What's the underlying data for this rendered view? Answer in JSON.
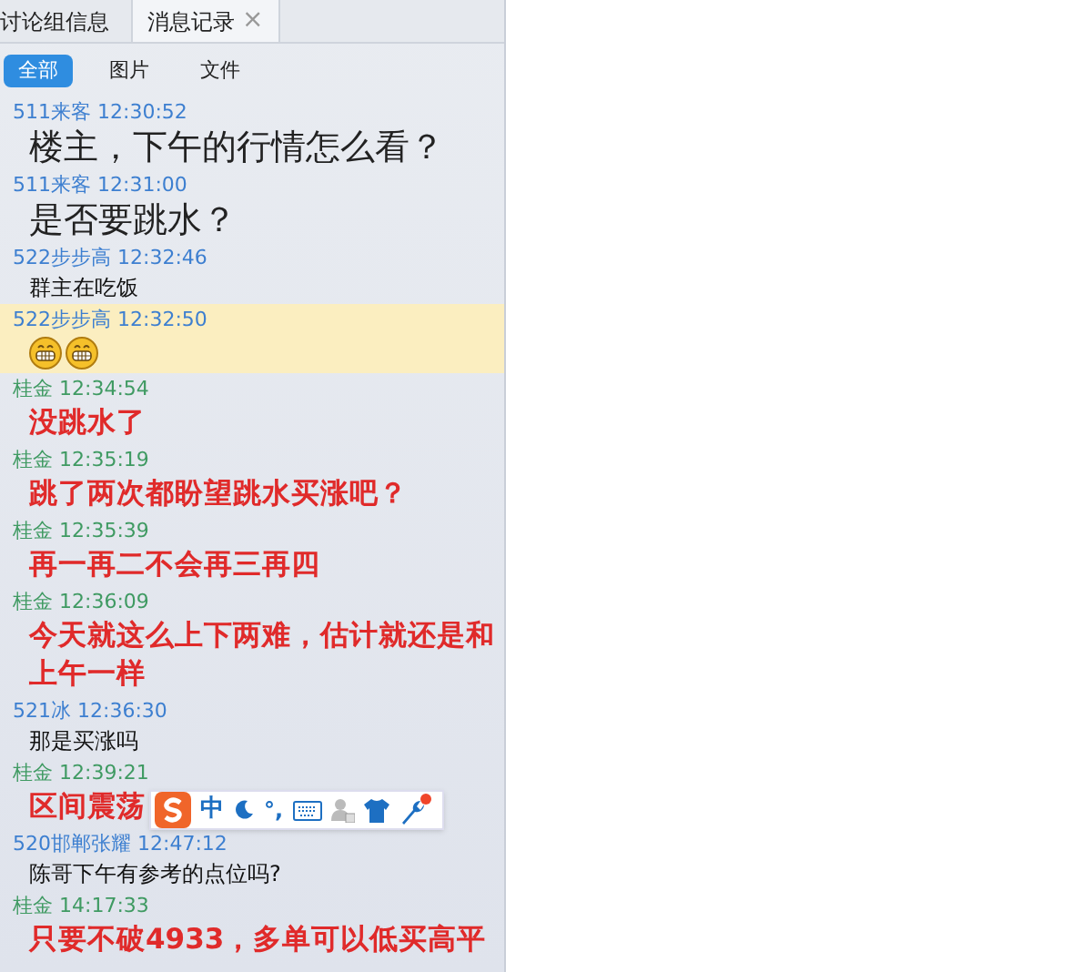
{
  "tabs": [
    {
      "label": "讨论组信息",
      "selected": false
    },
    {
      "label": "消息记录",
      "selected": true,
      "close_glyph": "×"
    }
  ],
  "filters": [
    {
      "label": "全部",
      "selected": true
    },
    {
      "label": "图片",
      "selected": false
    },
    {
      "label": "文件",
      "selected": false
    }
  ],
  "messages": [
    {
      "sender": "511来客",
      "time": "12:30:52",
      "color": "#3d7fd0",
      "kind": "large",
      "text": "楼主，下午的行情怎么看？",
      "selected": false
    },
    {
      "sender": "511来客",
      "time": "12:31:00",
      "color": "#3d7fd0",
      "kind": "large",
      "text": "是否要跳水？",
      "selected": false
    },
    {
      "sender": "522步步高",
      "time": "12:32:46",
      "color": "#3d7fd0",
      "kind": "small",
      "text": "群主在吃饭",
      "selected": false
    },
    {
      "sender": "522步步高",
      "time": "12:32:50",
      "color": "#3d7fd0",
      "kind": "emoji",
      "emojis": [
        {
          "kind": "grin"
        },
        {
          "kind": "grin"
        }
      ],
      "selected": true
    },
    {
      "sender": "桂金",
      "time": "12:34:54",
      "color": "#3f9a62",
      "kind": "red",
      "text": "没跳水了",
      "selected": false
    },
    {
      "sender": "桂金",
      "time": "12:35:19",
      "color": "#3f9a62",
      "kind": "red",
      "text": "跳了两次都盼望跳水买涨吧？",
      "selected": false
    },
    {
      "sender": "桂金",
      "time": "12:35:39",
      "color": "#3f9a62",
      "kind": "red",
      "text": "再一再二不会再三再四",
      "selected": false
    },
    {
      "sender": "桂金",
      "time": "12:36:09",
      "color": "#3f9a62",
      "kind": "red",
      "text": "今天就这么上下两难，估计就还是和上午一样",
      "selected": false
    },
    {
      "sender": "521冰",
      "time": "12:36:30",
      "color": "#3d7fd0",
      "kind": "small",
      "text": "那是买涨吗",
      "selected": false
    },
    {
      "sender": "桂金",
      "time": "12:39:21",
      "color": "#3f9a62",
      "kind": "red",
      "text": "区间震荡",
      "selected": false
    },
    {
      "sender": "520邯郸张耀",
      "time": "12:47:12",
      "color": "#3d7fd0",
      "kind": "small",
      "text": "陈哥下午有参考的点位吗?",
      "selected": false
    },
    {
      "sender": "桂金",
      "time": "14:17:33",
      "color": "#3f9a62",
      "kind": "red",
      "text": "只要不破4933，多单可以低买高平",
      "selected": false
    }
  ],
  "ime_toolbar": {
    "mode": "中",
    "punct": "°,"
  }
}
